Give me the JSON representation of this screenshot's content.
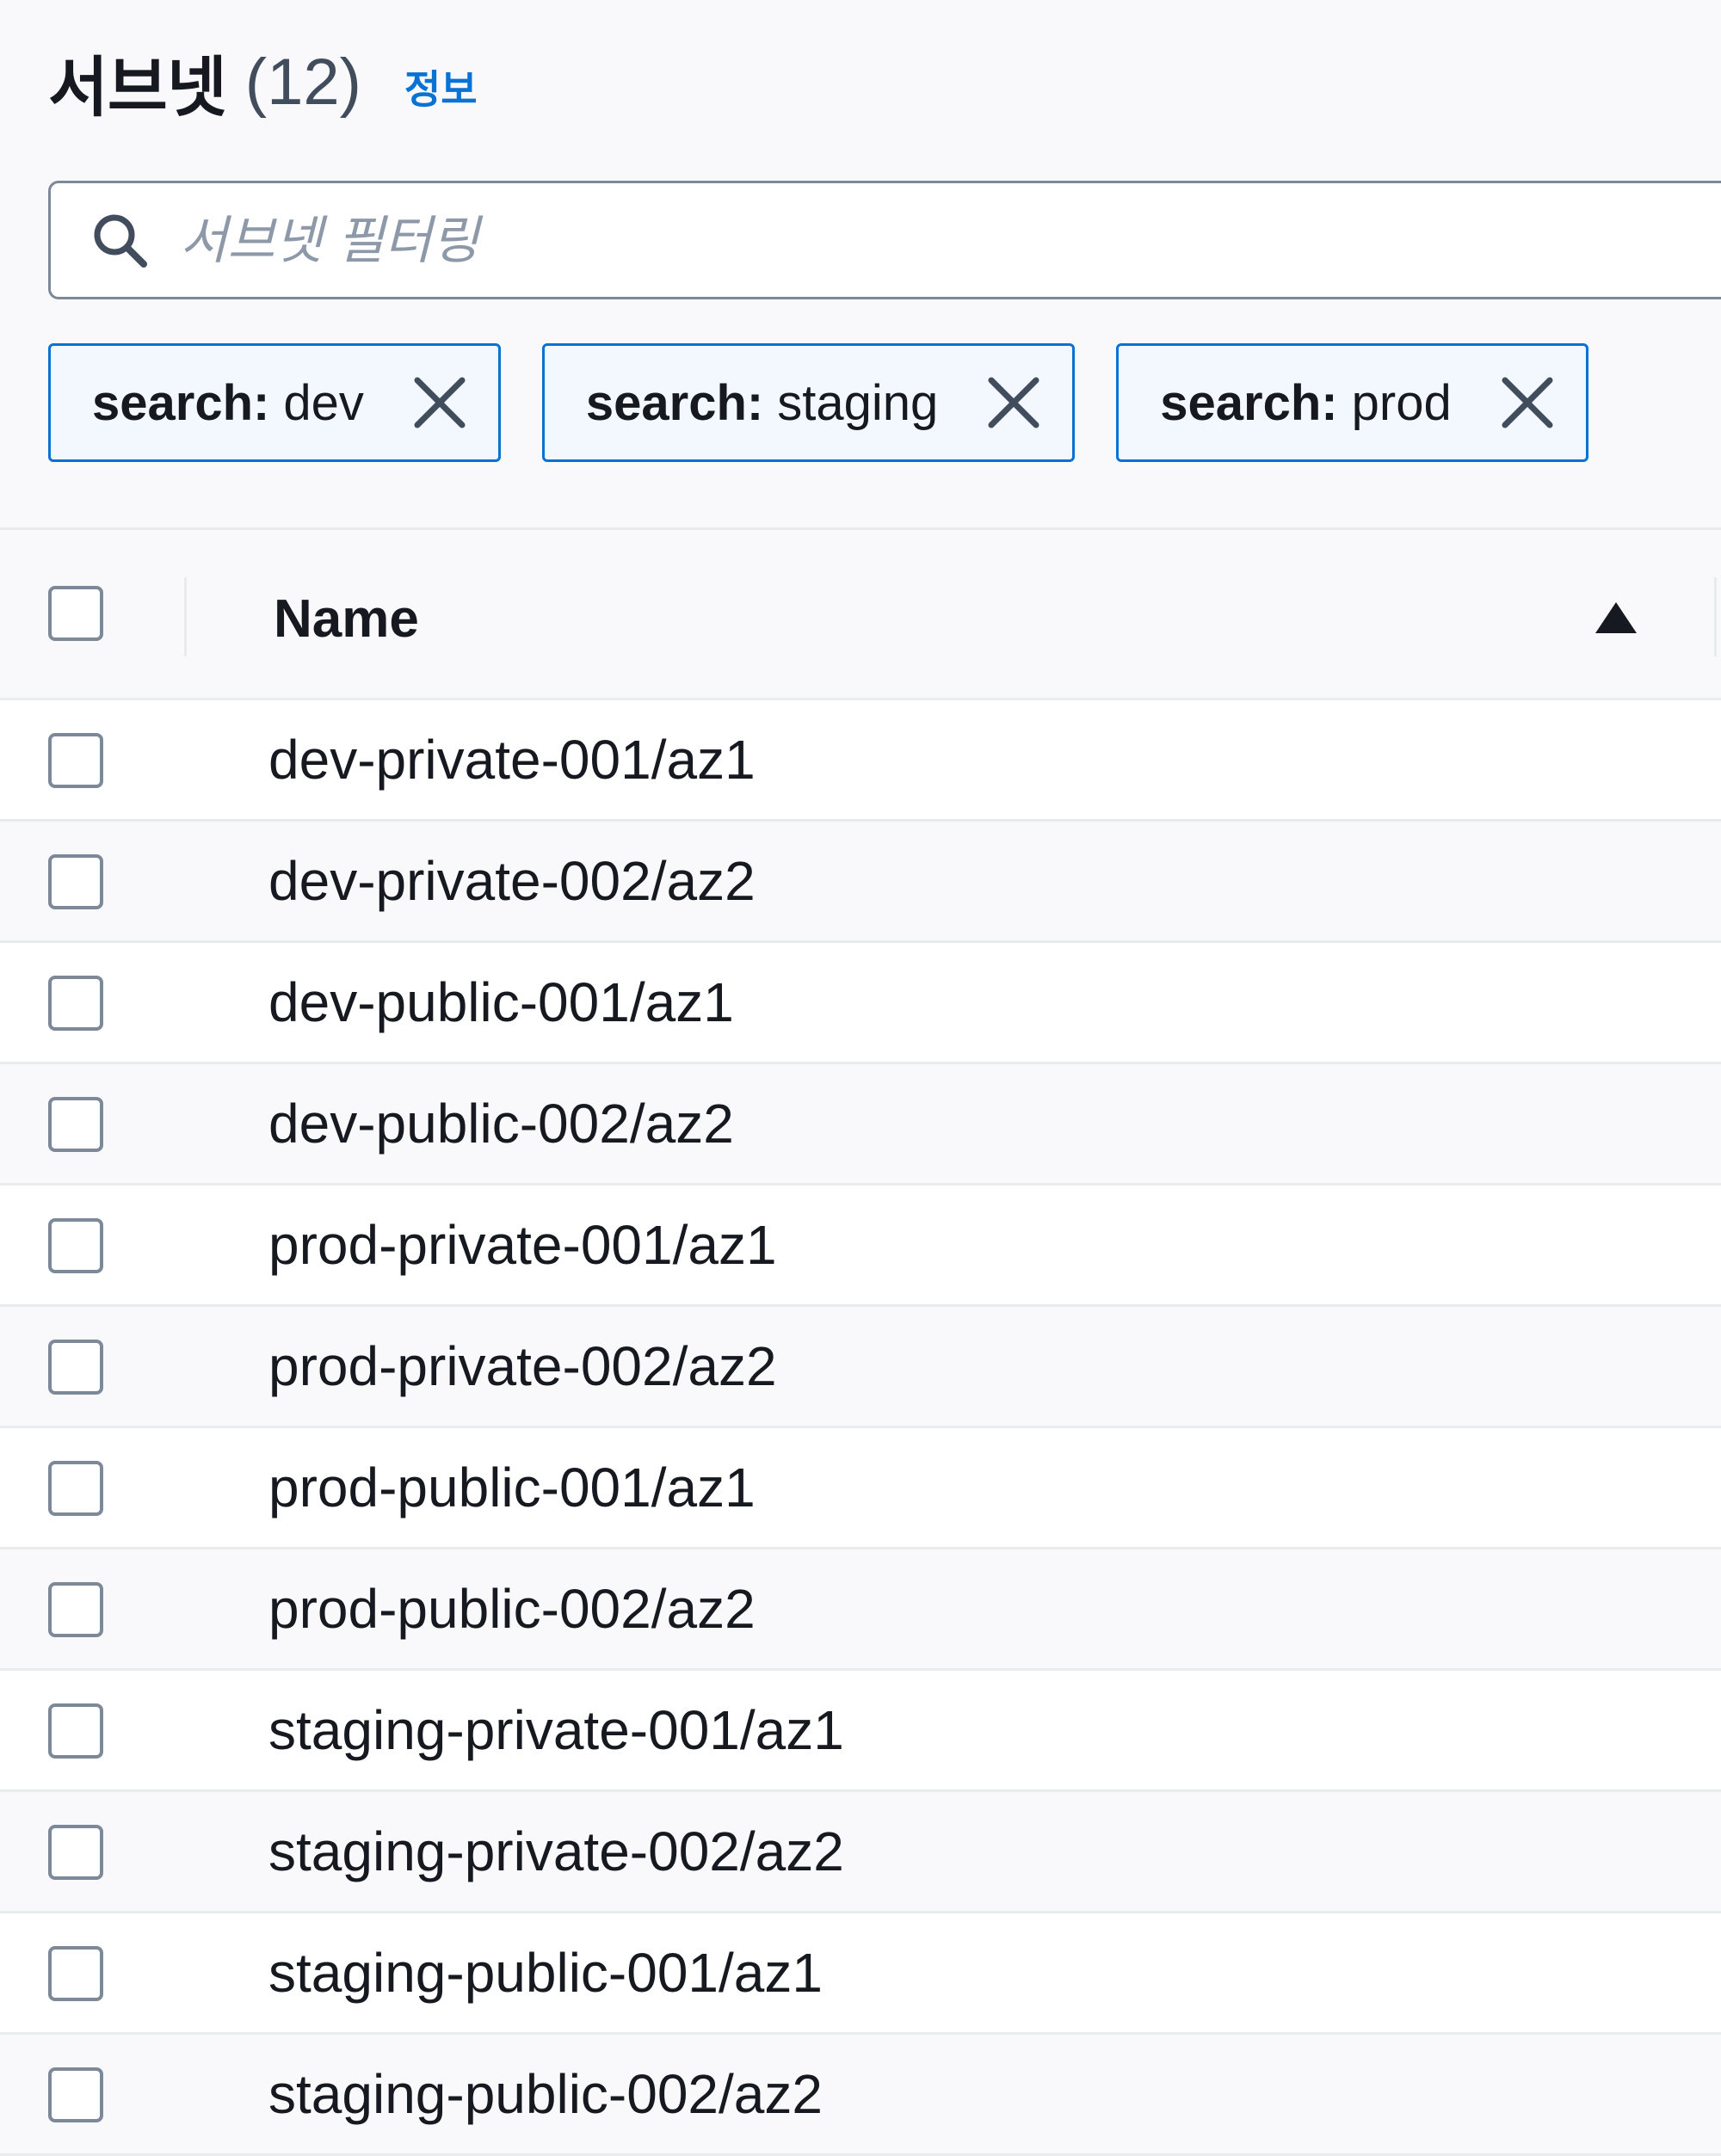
{
  "header": {
    "title": "서브넷",
    "count": "(12)",
    "info_link": "정보"
  },
  "search": {
    "placeholder": "서브넷 필터링",
    "value": ""
  },
  "tokens": [
    {
      "key": "search",
      "separator": ":",
      "value": "dev"
    },
    {
      "key": "search",
      "separator": ":",
      "value": "staging"
    },
    {
      "key": "search",
      "separator": ":",
      "value": "prod"
    }
  ],
  "table": {
    "columns": [
      {
        "label": "Name",
        "sort": "ascending"
      }
    ],
    "rows": [
      {
        "name": "dev-private-001/az1"
      },
      {
        "name": "dev-private-002/az2"
      },
      {
        "name": "dev-public-001/az1"
      },
      {
        "name": "dev-public-002/az2"
      },
      {
        "name": "prod-private-001/az1"
      },
      {
        "name": "prod-private-002/az2"
      },
      {
        "name": "prod-public-001/az1"
      },
      {
        "name": "prod-public-002/az2"
      },
      {
        "name": "staging-private-001/az1"
      },
      {
        "name": "staging-private-002/az2"
      },
      {
        "name": "staging-public-001/az1"
      },
      {
        "name": "staging-public-002/az2"
      }
    ]
  },
  "icons": {
    "search": "search-icon",
    "dismiss": "close-icon",
    "sort": "caret-up-filled-icon"
  },
  "colors": {
    "link": "#0972d3",
    "token_border": "#0972d3",
    "token_background": "#f2f8fd",
    "text": "#16191f",
    "placeholder": "#8d99a8"
  }
}
